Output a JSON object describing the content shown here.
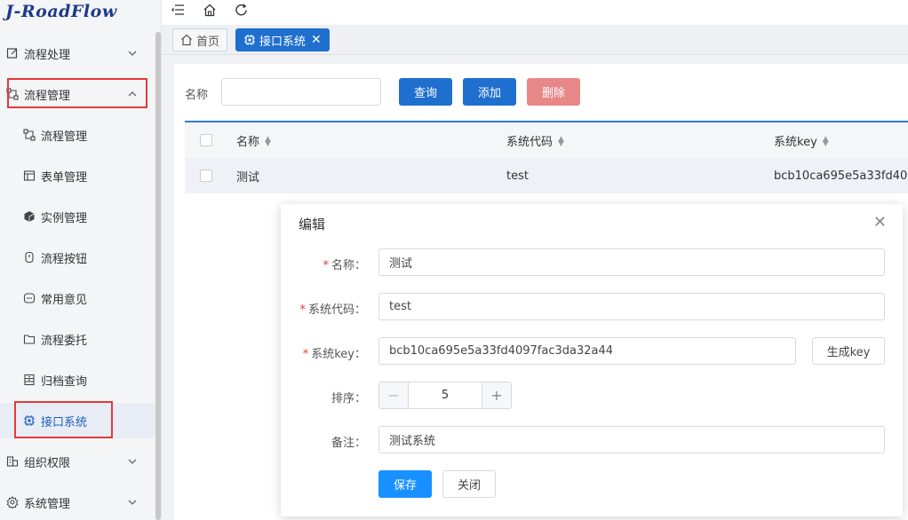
{
  "app": {
    "logo": "J-RoadFlow"
  },
  "sidebar": {
    "items": [
      {
        "label": "流程处理",
        "icon": "edit-icon",
        "expanded": false
      },
      {
        "label": "流程管理",
        "icon": "flow-icon",
        "expanded": true
      },
      {
        "label": "流程管理",
        "icon": "flow-icon"
      },
      {
        "label": "表单管理",
        "icon": "form-icon"
      },
      {
        "label": "实例管理",
        "icon": "cube-icon"
      },
      {
        "label": "流程按钮",
        "icon": "button-icon"
      },
      {
        "label": "常用意见",
        "icon": "comment-icon"
      },
      {
        "label": "流程委托",
        "icon": "folder-icon"
      },
      {
        "label": "归档查询",
        "icon": "archive-icon"
      },
      {
        "label": "接口系统",
        "icon": "chip-icon",
        "active": true
      },
      {
        "label": "组织权限",
        "icon": "org-icon",
        "expanded": false
      },
      {
        "label": "系统管理",
        "icon": "settings-icon",
        "expanded": false
      }
    ]
  },
  "tabs": [
    {
      "label": "首页",
      "icon": "home-icon"
    },
    {
      "label": "接口系统",
      "icon": "chip-icon",
      "active": true
    }
  ],
  "search": {
    "label": "名称",
    "placeholder": "",
    "query_label": "查询",
    "add_label": "添加",
    "delete_label": "删除"
  },
  "table": {
    "columns": [
      "名称",
      "系统代码",
      "系统key"
    ],
    "rows": [
      [
        "测试",
        "test",
        "bcb10ca695e5a33fd40"
      ]
    ]
  },
  "modal": {
    "title": "编辑",
    "fields": {
      "name_label": "名称：",
      "name_value": "测试",
      "code_label": "系统代码：",
      "code_value": "test",
      "key_label": "系统key：",
      "key_value": "bcb10ca695e5a33fd4097fac3da32a44",
      "gen_key_label": "生成key",
      "order_label": "排序：",
      "order_value": "5",
      "note_label": "备注：",
      "note_value": "测试系统"
    },
    "save_label": "保存",
    "close_label": "关闭"
  },
  "colors": {
    "primary": "#1f6fcf",
    "save": "#1890ff",
    "danger": "#e06060",
    "highlight": "#e53935"
  }
}
